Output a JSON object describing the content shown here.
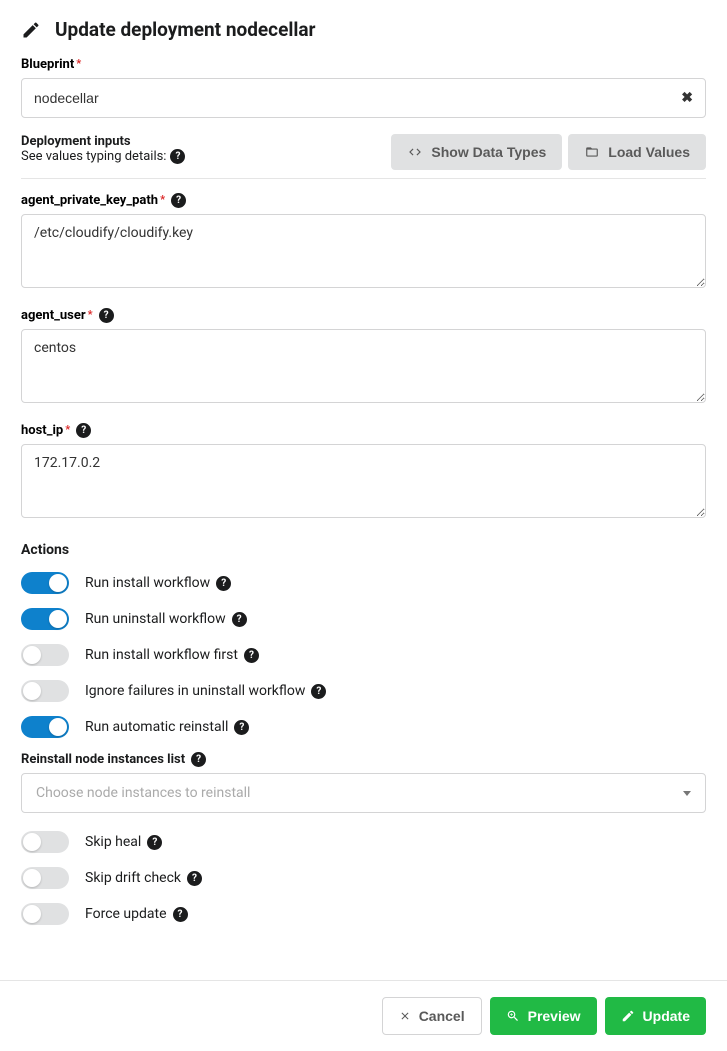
{
  "header": {
    "title": "Update deployment nodecellar"
  },
  "blueprint": {
    "label": "Blueprint",
    "value": "nodecellar"
  },
  "deployment_inputs": {
    "title": "Deployment inputs",
    "subtitle": "See values typing details:",
    "show_data_types": "Show Data Types",
    "load_values": "Load Values"
  },
  "inputs": {
    "agent_private_key_path": {
      "label": "agent_private_key_path",
      "value": "/etc/cloudify/cloudify.key"
    },
    "agent_user": {
      "label": "agent_user",
      "value": "centos"
    },
    "host_ip": {
      "label": "host_ip",
      "value": "172.17.0.2"
    }
  },
  "actions": {
    "heading": "Actions",
    "run_install_workflow": {
      "label": "Run install workflow",
      "on": true
    },
    "run_uninstall_workflow": {
      "label": "Run uninstall workflow",
      "on": true
    },
    "run_install_workflow_first": {
      "label": "Run install workflow first",
      "on": false
    },
    "ignore_failures": {
      "label": "Ignore failures in uninstall workflow",
      "on": false
    },
    "run_automatic_reinstall": {
      "label": "Run automatic reinstall",
      "on": true
    },
    "reinstall_list": {
      "label": "Reinstall node instances list",
      "placeholder": "Choose node instances to reinstall"
    },
    "skip_heal": {
      "label": "Skip heal",
      "on": false
    },
    "skip_drift_check": {
      "label": "Skip drift check",
      "on": false
    },
    "force_update": {
      "label": "Force update",
      "on": false
    }
  },
  "footer": {
    "cancel": "Cancel",
    "preview": "Preview",
    "update": "Update"
  }
}
